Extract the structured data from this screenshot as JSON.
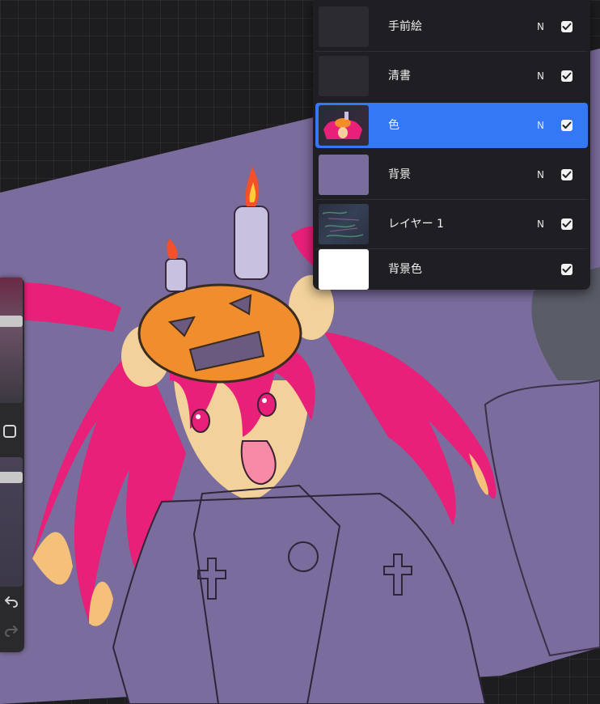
{
  "layers": [
    {
      "name": "手前絵",
      "blend": "N",
      "visible": true,
      "selected": false,
      "thumb": "dark-thumb"
    },
    {
      "name": "清書",
      "blend": "N",
      "visible": true,
      "selected": false,
      "thumb": "dark-thumb"
    },
    {
      "name": "色",
      "blend": "N",
      "visible": true,
      "selected": true,
      "thumb": "color-thumb"
    },
    {
      "name": "背景",
      "blend": "N",
      "visible": true,
      "selected": false,
      "thumb": "purple-thumb"
    },
    {
      "name": "レイヤー 1",
      "blend": "N",
      "visible": true,
      "selected": false,
      "thumb": "sketch-thumb"
    },
    {
      "name": "背景色",
      "blend": "",
      "visible": true,
      "selected": false,
      "thumb": "white-thumb"
    }
  ],
  "sidebar": {
    "brush_size_level": 0.67,
    "opacity_level": 0.19
  },
  "icons": {
    "undo": "undo-icon",
    "redo": "redo-icon",
    "modify": "square-modify-icon",
    "visibility": "checkmark-icon"
  },
  "colors": {
    "canvas_purple": "#7a6c9c",
    "selected_layer": "#3478f6",
    "panel_bg": "#1f1f23",
    "hair_pink": "#e8207a",
    "pumpkin_orange": "#f08d2c"
  }
}
